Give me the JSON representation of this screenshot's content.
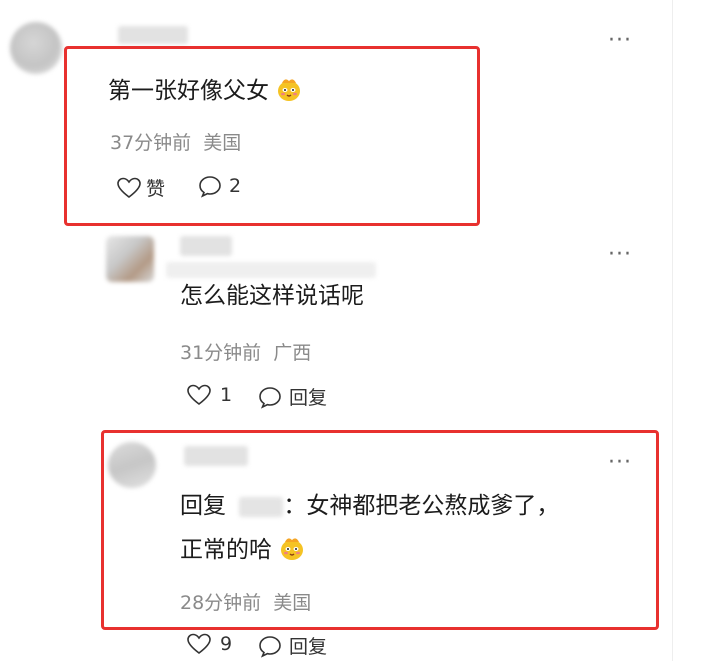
{
  "comment1": {
    "text": "第一张好像父女",
    "time": "37分钟前",
    "location": "美国",
    "like_label": "赞",
    "reply_count": "2",
    "more": "···"
  },
  "reply1": {
    "text": "怎么能这样说话呢",
    "time": "31分钟前",
    "location": "广西",
    "like_count": "1",
    "reply_label": "回复",
    "more": "···"
  },
  "reply2": {
    "prefix": "回复",
    "text_line1": "：女神都把老公熬成爹了，",
    "text_line2": "正常的哈",
    "time": "28分钟前",
    "location": "美国",
    "like_count": "9",
    "reply_label": "回复",
    "more": "···"
  },
  "colors": {
    "highlight_border": "#e8312f",
    "meta_text": "#8a8a8a"
  }
}
